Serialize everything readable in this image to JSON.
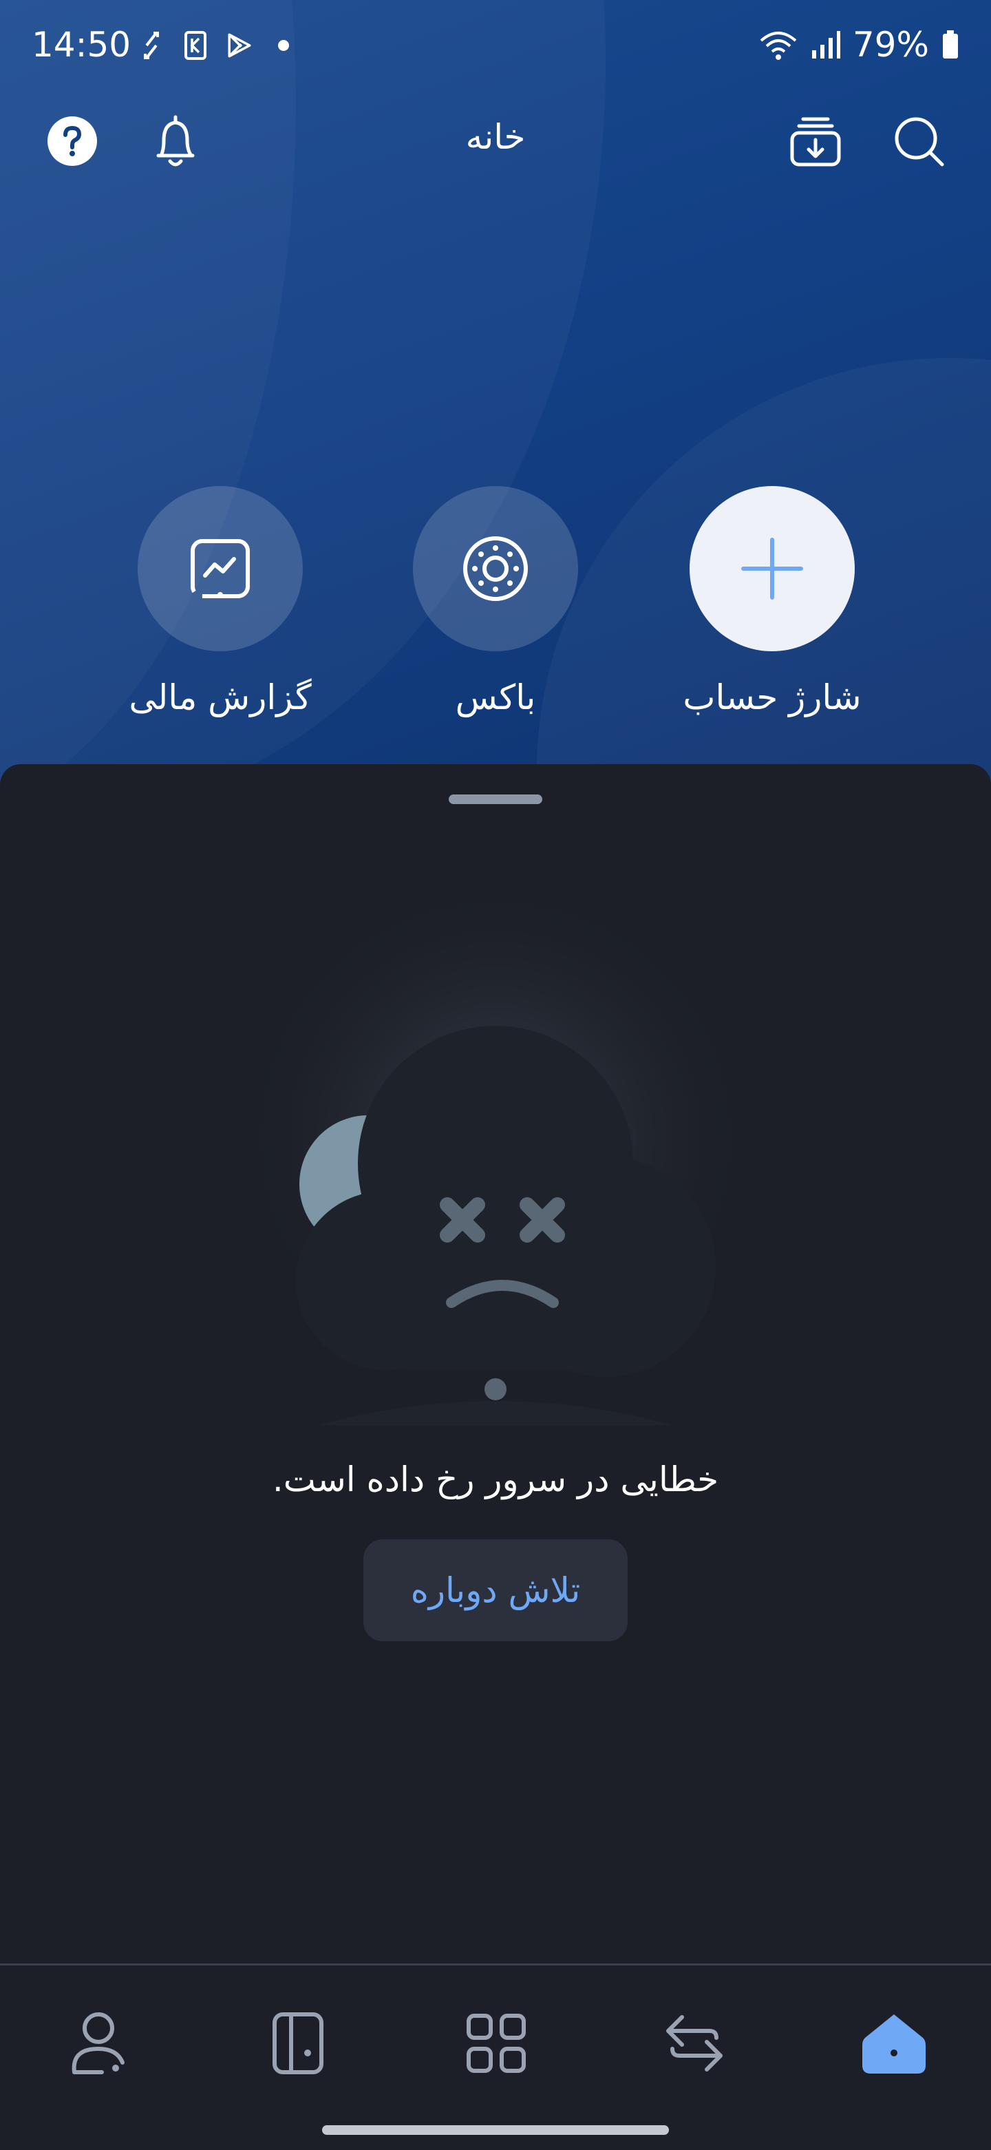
{
  "status_bar": {
    "time": "14:50",
    "battery": "79%",
    "icons": [
      "sync-icon",
      "k-badge-icon",
      "play-store-icon",
      "dot-icon",
      "wifi-icon",
      "signal-icon",
      "battery-icon"
    ]
  },
  "header": {
    "title": "خانه",
    "left_icons": [
      "help-icon",
      "bell-icon"
    ],
    "right_icons": [
      "download-inbox-icon",
      "search-icon"
    ]
  },
  "quick_actions": [
    {
      "label": "گزارش مالی",
      "icon": "financial-report-icon"
    },
    {
      "label": "باکس",
      "icon": "box-icon"
    },
    {
      "label": "شارژ حساب",
      "icon": "plus-icon"
    }
  ],
  "error": {
    "message": "خطایی در سرور رخ داده است.",
    "retry_label": "تلاش دوباره"
  },
  "bottom_nav": {
    "items": [
      "profile-icon",
      "cards-icon",
      "services-grid-icon",
      "transfer-icon",
      "home-icon"
    ],
    "active": "home-icon"
  },
  "colors": {
    "hero_blue": "#134085",
    "sheet_bg": "#1c1f27",
    "accent": "#6fa8f5",
    "button_bg": "#2b303c"
  }
}
